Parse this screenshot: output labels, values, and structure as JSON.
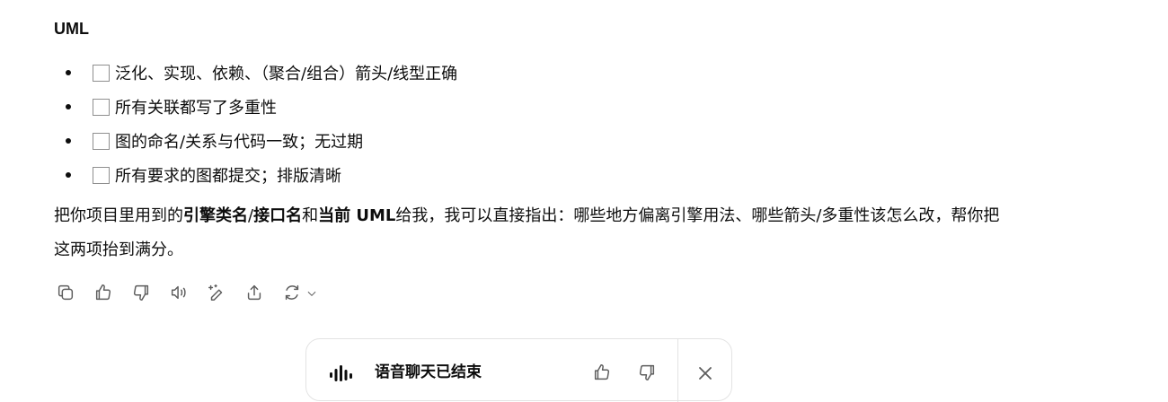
{
  "section": {
    "heading": "UML"
  },
  "checklist": [
    {
      "label": "泛化、实现、依赖、（聚合/组合）箭头/线型正确",
      "checked": false
    },
    {
      "label": "所有关联都写了多重性",
      "checked": false
    },
    {
      "label": "图的命名/关系与代码一致；无过期",
      "checked": false
    },
    {
      "label": "所有要求的图都提交；排版清晰",
      "checked": false
    }
  ],
  "paragraph": {
    "p1": "把你项目里用到的",
    "b1": "引擎类名",
    "p2": "/",
    "b2": "接口名",
    "p3": "和",
    "b3": "当前 UML",
    "p4": "给我，我可以直接指出：哪些地方偏离引擎用法、哪些箭头/多重性该怎么改，帮你把这两项抬到满分。"
  },
  "actions": [
    "copy-icon",
    "thumbs-up-icon",
    "thumbs-down-icon",
    "read-aloud-icon",
    "edit-sparkle-icon",
    "share-icon",
    "regenerate-icon",
    "chevron-down-icon"
  ],
  "voice_card": {
    "title": "语音聊天已结束",
    "icons": [
      "voice-wave-icon",
      "thumbs-up-icon",
      "thumbs-down-icon",
      "close-icon"
    ]
  }
}
